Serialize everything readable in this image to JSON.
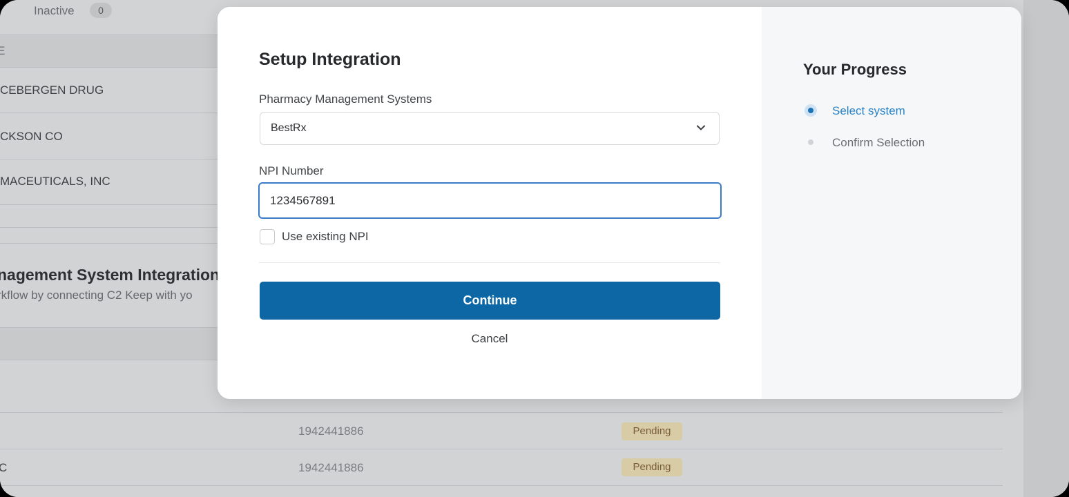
{
  "background": {
    "filter": {
      "label": "Inactive",
      "count": "0"
    },
    "column_header_partial": "E",
    "rows_top": [
      "CEBERGEN DRUG",
      "CKSON CO",
      "MACEUTICALS, INC"
    ],
    "section": {
      "title": "nagement System Integration",
      "subtitle": "rkflow by connecting C2 Keep with yo"
    },
    "rows_bottom": [
      {
        "name": "",
        "npi": "1942441886",
        "status": "Pending"
      },
      {
        "name": "C",
        "npi": "1942441886",
        "status": "Pending"
      }
    ]
  },
  "modal": {
    "title": "Setup Integration",
    "system_label": "Pharmacy Management Systems",
    "system_value": "BestRx",
    "npi_label": "NPI Number",
    "npi_value": "1234567891",
    "checkbox_label": "Use existing NPI",
    "continue_label": "Continue",
    "cancel_label": "Cancel",
    "progress": {
      "title": "Your Progress",
      "steps": [
        {
          "label": "Select system",
          "state": "active"
        },
        {
          "label": "Confirm Selection",
          "state": "inactive"
        }
      ]
    }
  },
  "colors": {
    "primary_button": "#0d67a5",
    "active_step": "#2a84c6",
    "input_focus": "#3a7bc8",
    "pending_badge": "#d7cca5"
  },
  "icons": {
    "select_chevron": "chevron-down-icon",
    "active_step": "radio-dot-icon",
    "inactive_step": "dot-icon"
  }
}
